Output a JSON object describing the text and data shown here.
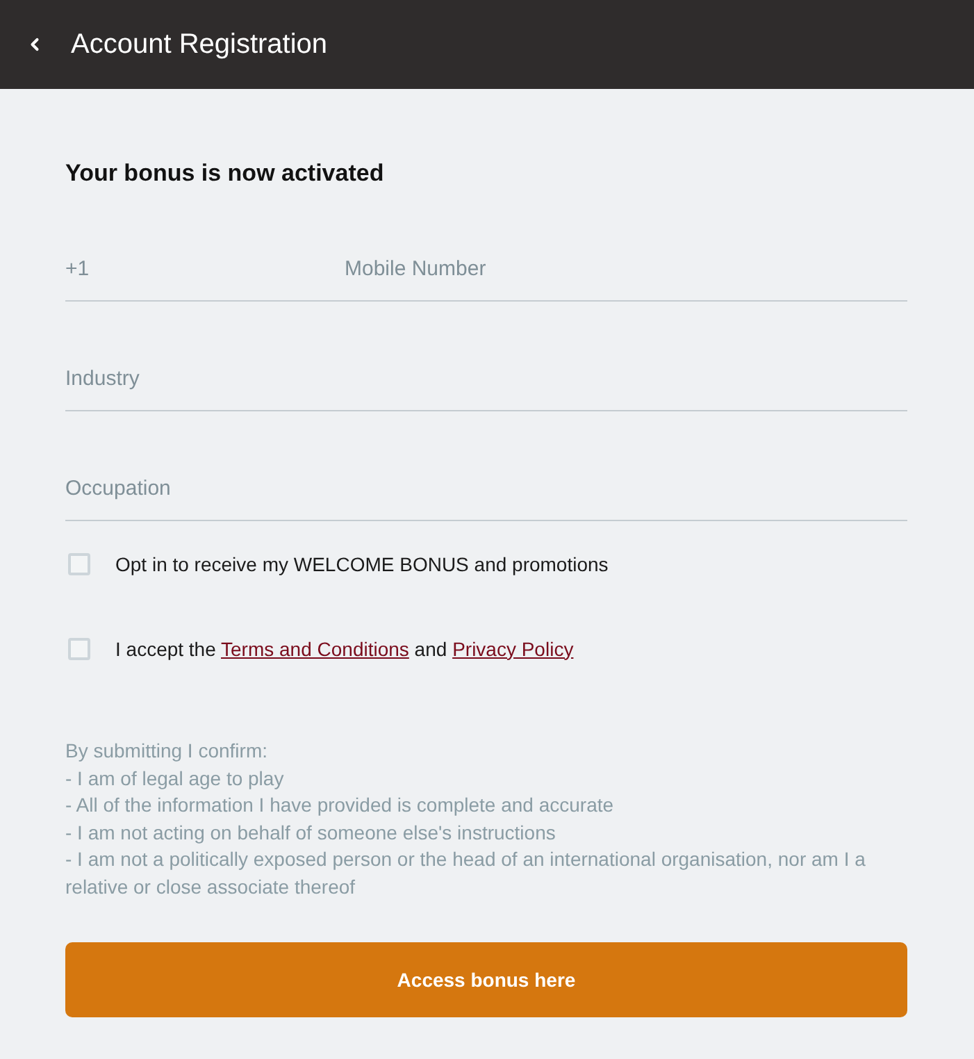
{
  "header": {
    "title": "Account Registration"
  },
  "form": {
    "heading": "Your bonus is now activated",
    "phone": {
      "country_code": "+1",
      "placeholder": "Mobile Number"
    },
    "fields": [
      {
        "placeholder": "Industry"
      },
      {
        "placeholder": "Occupation"
      }
    ],
    "checkboxes": [
      {
        "checked": false,
        "segments": [
          {
            "kind": "text",
            "text": "Opt in to receive my WELCOME BONUS and promotions"
          }
        ]
      },
      {
        "checked": false,
        "segments": [
          {
            "kind": "text",
            "text": "I accept the "
          },
          {
            "kind": "link",
            "text": "Terms and Conditions"
          },
          {
            "kind": "text",
            "text": " and "
          },
          {
            "kind": "link",
            "text": "Privacy Policy"
          }
        ]
      }
    ],
    "disclaimer": {
      "intro": "By submitting I confirm:",
      "items": [
        "- I am of legal age to play",
        "- All of the information I have provided is complete and accurate",
        "- I am not acting on behalf of someone else's instructions",
        "- I am not a politically exposed person or the head of an international organisation, nor am I a relative or close associate thereof"
      ]
    },
    "submit_button": "Access bonus here"
  }
}
